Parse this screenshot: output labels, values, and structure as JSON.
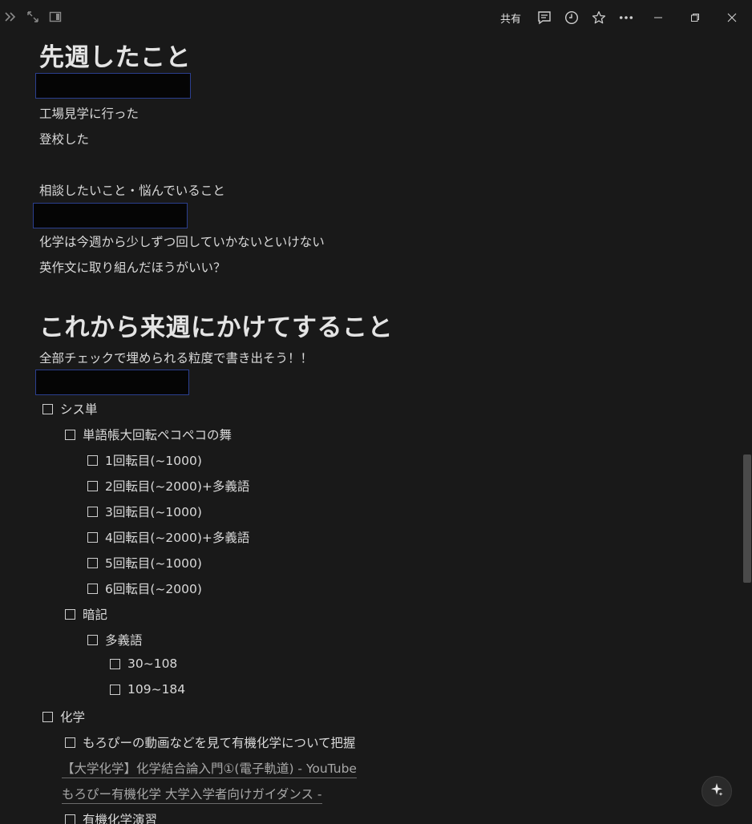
{
  "toolbar": {
    "share_label": "共有"
  },
  "page": {
    "heading_last_week": "先週したこと",
    "last_week_items": [
      "工場見学に行った",
      "登校した"
    ],
    "consult_label": "相談したいこと・悩んでいること",
    "consult_items": [
      "化学は今週から少しずつ回していかないといけない",
      "英作文に取り組んだほうがいい？"
    ],
    "heading_next_week": "これから来週にかけてすること",
    "next_week_note": "全部チェックで埋められる粒度で書き出そう！！",
    "todos": [
      {
        "label": "シス単",
        "checked": false
      },
      {
        "label": "単語帳大回転ペコペコの舞",
        "checked": false
      },
      {
        "label": "1回転目(~1000)",
        "checked": false
      },
      {
        "label": "2回転目(~2000)+多義語",
        "checked": false
      },
      {
        "label": "3回転目(~1000)",
        "checked": false
      },
      {
        "label": "4回転目(~2000)+多義語",
        "checked": false
      },
      {
        "label": "5回転目(~1000)",
        "checked": false
      },
      {
        "label": "6回転目(~2000)",
        "checked": false
      },
      {
        "label": "暗記",
        "checked": false
      },
      {
        "label": "多義語",
        "checked": false
      },
      {
        "label": "30~108",
        "checked": false
      },
      {
        "label": "109~184",
        "checked": false
      },
      {
        "label": "化学",
        "checked": false
      },
      {
        "label": "もろぴーの動画などを見て有機化学について把握",
        "checked": false
      },
      {
        "label": "有機化学演習",
        "checked": false
      }
    ],
    "links": [
      "【大学化学】化学結合論入門①(電子軌道) - YouTube",
      "もろぴー有機化学 大学入学者向けガイダンス -"
    ]
  },
  "icons": {
    "expand_sidebar": "double-chevron-right-icon",
    "fullscreen": "diagonal-arrows-icon",
    "panel": "panel-icon",
    "comment": "comment-icon",
    "history": "clock-icon",
    "favorite": "star-icon",
    "more": "more-icon",
    "minimize": "minimize-icon",
    "restore": "restore-icon",
    "close": "close-icon",
    "ai": "sparkle-icon"
  }
}
